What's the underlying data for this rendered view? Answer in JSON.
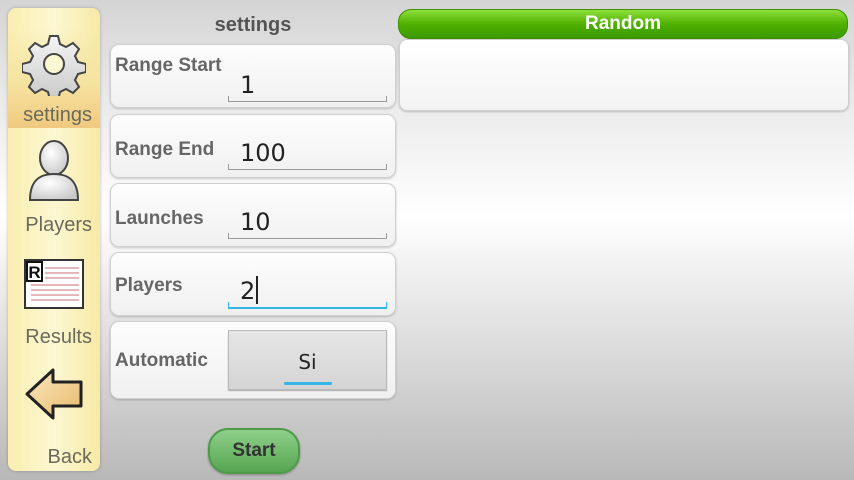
{
  "sidebar": {
    "items": [
      {
        "label": "settings",
        "icon": "gear-icon",
        "active": true
      },
      {
        "label": "Players",
        "icon": "person-icon",
        "active": false
      },
      {
        "label": "Results",
        "icon": "results-document-icon",
        "active": false
      },
      {
        "label": "Back",
        "icon": "back-arrow-icon",
        "active": false
      }
    ]
  },
  "settings": {
    "title": "settings",
    "rows": [
      {
        "label": "Range Start",
        "value": "1"
      },
      {
        "label": "Range End",
        "value": "100"
      },
      {
        "label": "Launches",
        "value": "10"
      },
      {
        "label": "Players",
        "value": "2"
      },
      {
        "label": "Automatic",
        "value": "Si"
      }
    ],
    "start_label": "Start"
  },
  "random": {
    "title": "Random",
    "result": ""
  },
  "colors": {
    "accent": "#33b5e5",
    "header_green": "#4fb000",
    "start_green": "#56a551",
    "sidebar_bg": "#fdf7d2"
  }
}
